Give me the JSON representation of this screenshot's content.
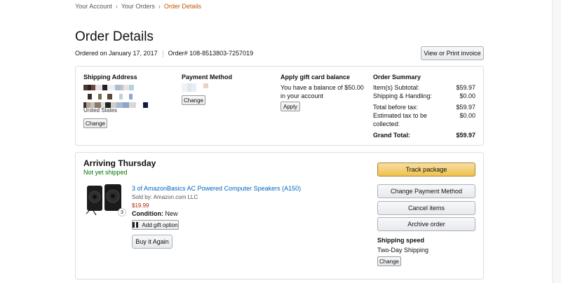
{
  "breadcrumb": {
    "account": "Your Account",
    "orders": "Your Orders",
    "current": "Order Details",
    "sep": "›"
  },
  "title": "Order Details",
  "meta": {
    "ordered": "Ordered on January 17, 2017",
    "order_no": "Order# 108-8513803-7257019"
  },
  "invoice_label": "View or Print invoice",
  "shipping": {
    "heading": "Shipping Address",
    "last_line": "United States",
    "change": "Change"
  },
  "payment": {
    "heading": "Payment Method",
    "change": "Change"
  },
  "giftcard": {
    "heading": "Apply gift card balance",
    "text": "You have a balance of $50.00 in your account",
    "apply": "Apply"
  },
  "summary": {
    "heading": "Order Summary",
    "rows": [
      {
        "label": "Item(s) Subtotal:",
        "value": "$59.97"
      },
      {
        "label": "Shipping & Handling:",
        "value": "$0.00"
      },
      {
        "label": "Total before tax:",
        "value": "$59.97"
      },
      {
        "label": "Estimated tax to be collected:",
        "value": "$0.00"
      },
      {
        "label": "Grand Total:",
        "value": "$59.97"
      }
    ]
  },
  "shipment": {
    "heading": "Arriving Thursday",
    "status": "Not yet shipped",
    "item": {
      "title": "3 of AmazonBasics AC Powered Computer Speakers (A150)",
      "sold_by": "Sold by: Amazon.com LLC",
      "price": "$19.99",
      "condition_label": "Condition:",
      "condition": "New",
      "qty": "3",
      "gift": "Add gift option",
      "buy_again": "Buy it Again"
    },
    "actions": {
      "track": "Track package",
      "change_payment": "Change Payment Method",
      "cancel": "Cancel items",
      "archive": "Archive order"
    },
    "speed": {
      "heading": "Shipping speed",
      "value": "Two-Day Shipping",
      "change": "Change"
    }
  },
  "colors": {
    "accent": "#c45500",
    "link": "#0066c0",
    "green": "#007600",
    "price": "#b12704",
    "track_btn": "#f0c14b"
  }
}
